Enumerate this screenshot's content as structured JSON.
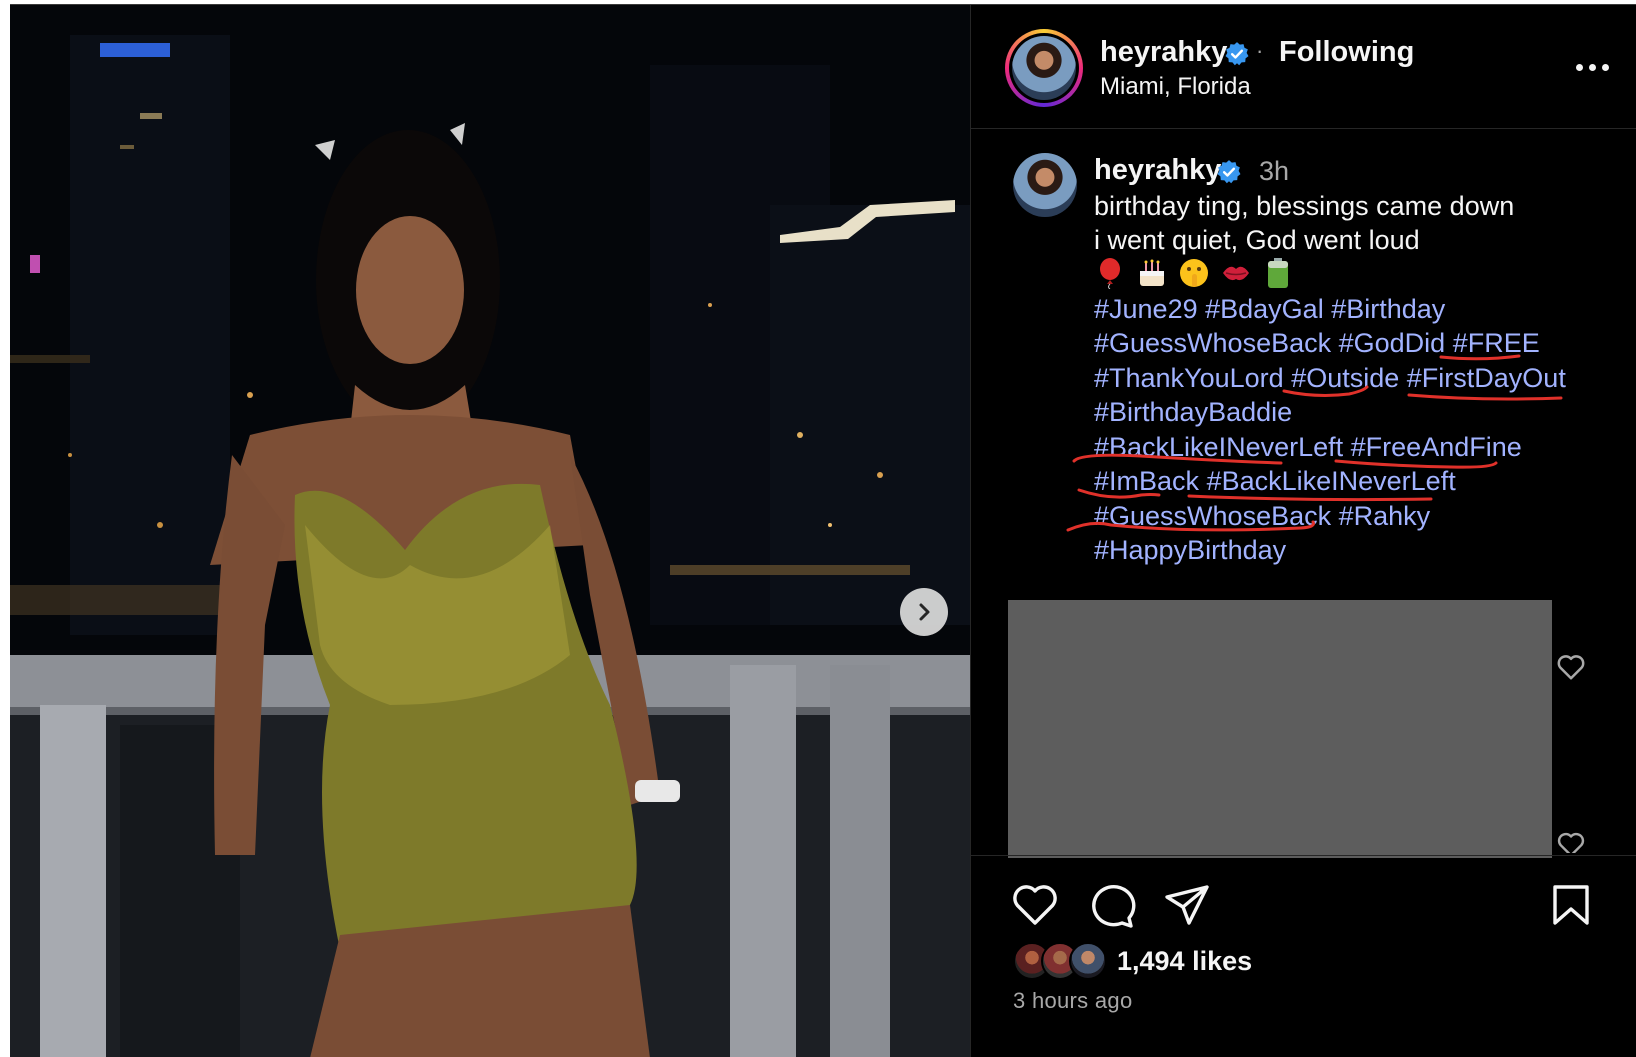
{
  "post": {
    "username": "heyrahky",
    "follow_status": "Following",
    "separator": "·",
    "location": "Miami, Florida"
  },
  "caption": {
    "username": "heyrahky",
    "time": "3h",
    "lines": [
      "birthday ting, blessings came down",
      "i went quiet, God went loud"
    ],
    "emojis": [
      "balloon-emoji",
      "birthday-cake-emoji",
      "shushing-face-emoji",
      "kiss-mark-emoji",
      "battery-emoji"
    ],
    "hashtag_lines": [
      [
        "#June29",
        "#BdayGal",
        "#Birthday"
      ],
      [
        "#GuessWhoseBack",
        "#GodDid",
        "#FREE"
      ],
      [
        "#ThankYouLord",
        "#Outside",
        "#FirstDayOut"
      ],
      [
        "#BirthdayBaddie"
      ],
      [
        "#BackLikeINeverLeft",
        "#FreeAndFine"
      ],
      [
        "#ImBack",
        "#BackLikeINeverLeft"
      ],
      [
        "#GuessWhoseBack",
        "#Rahky"
      ],
      [
        "#HappyBirthday"
      ]
    ]
  },
  "engagement": {
    "likes": "1,494 likes",
    "time_ago": "3 hours ago"
  },
  "colors": {
    "background": "#000000",
    "text": "#f5f5f5",
    "muted": "#a8a8a8",
    "hashtag": "#a2b3ff",
    "verified": "#0095f6",
    "annotation": "#e0312a",
    "redacted_box": "#5d5d5d"
  },
  "icons": [
    "verified-badge-icon",
    "more-options-icon",
    "next-arrow-icon",
    "like-heart-icon",
    "comment-icon",
    "share-icon",
    "save-icon",
    "comment-like-icon"
  ]
}
